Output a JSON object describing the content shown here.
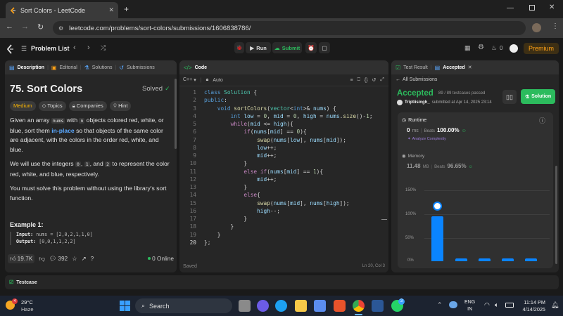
{
  "browser": {
    "tab_title": "Sort Colors - LeetCode",
    "url": "leetcode.com/problems/sort-colors/submissions/1606838786/"
  },
  "topbar": {
    "problem_list": "Problem List",
    "run": "Run",
    "submit": "Submit",
    "streak": "0",
    "premium": "Premium"
  },
  "description_panel": {
    "tabs": [
      "Description",
      "Editorial",
      "Solutions",
      "Submissions"
    ],
    "title": "75. Sort Colors",
    "status": "Solved",
    "tags": [
      "Medium",
      "Topics",
      "Companies",
      "Hint"
    ],
    "para1_a": "Given an array ",
    "para1_code": "nums",
    "para1_b": " with ",
    "para1_n": "n",
    "para1_c": " objects colored red, white, or blue, sort them ",
    "para1_link": "in-place",
    "para1_d": " so that objects of the same color are adjacent, with the colors in the order red, white, and blue.",
    "para2_a": "We will use the integers ",
    "c0": "0",
    "s1": ", ",
    "c1": "1",
    "s2": ", and ",
    "c2": "2",
    "para2_b": " to represent the color red, white, and blue, respectively.",
    "para3": "You must solve this problem without using the library's sort function.",
    "example_title": "Example 1:",
    "input_label": "Input:",
    "input_value": "nums = [2,0,2,1,1,0]",
    "output_label": "Output:",
    "output_value": "[0,0,1,1,2,2]",
    "likes": "19.7K",
    "comments": "392",
    "online": "0 Online"
  },
  "code_panel": {
    "title": "Code",
    "language": "C++",
    "auto": "Auto",
    "saved": "Saved",
    "cursor": "Ln 20, Col 3",
    "lines": [
      [
        [
          "kw2",
          "class "
        ],
        [
          "ty",
          "Solution"
        ],
        [
          "pl",
          " {"
        ]
      ],
      [
        [
          "kw2",
          "public"
        ],
        [
          "pl",
          ":"
        ]
      ],
      [
        [
          "pl",
          "    "
        ],
        [
          "kw2",
          "void "
        ],
        [
          "fn",
          "sortColors"
        ],
        [
          "pl",
          "("
        ],
        [
          "ty",
          "vector"
        ],
        [
          "pl",
          "<"
        ],
        [
          "kw2",
          "int"
        ],
        [
          "pl",
          ">& "
        ],
        [
          "id",
          "nums"
        ],
        [
          "pl",
          ") {"
        ]
      ],
      [
        [
          "pl",
          "        "
        ],
        [
          "kw2",
          "int "
        ],
        [
          "id",
          "low"
        ],
        [
          "pl",
          " = "
        ],
        [
          "num",
          "0"
        ],
        [
          "pl",
          ", "
        ],
        [
          "id",
          "mid"
        ],
        [
          "pl",
          " = "
        ],
        [
          "num",
          "0"
        ],
        [
          "pl",
          ", "
        ],
        [
          "id",
          "high"
        ],
        [
          "pl",
          " = "
        ],
        [
          "id",
          "nums"
        ],
        [
          "pl",
          "."
        ],
        [
          "fn",
          "size"
        ],
        [
          "pl",
          "()-"
        ],
        [
          "num",
          "1"
        ],
        [
          "pl",
          ";"
        ]
      ],
      [
        [
          "pl",
          "        "
        ],
        [
          "kw",
          "while"
        ],
        [
          "pl",
          "("
        ],
        [
          "id",
          "mid"
        ],
        [
          "pl",
          " <= "
        ],
        [
          "id",
          "high"
        ],
        [
          "pl",
          "){"
        ]
      ],
      [
        [
          "pl",
          "            "
        ],
        [
          "kw",
          "if"
        ],
        [
          "pl",
          "("
        ],
        [
          "id",
          "nums"
        ],
        [
          "pl",
          "["
        ],
        [
          "id",
          "mid"
        ],
        [
          "pl",
          "] == "
        ],
        [
          "num",
          "0"
        ],
        [
          "pl",
          "){"
        ]
      ],
      [
        [
          "pl",
          "                "
        ],
        [
          "fn",
          "swap"
        ],
        [
          "pl",
          "("
        ],
        [
          "id",
          "nums"
        ],
        [
          "pl",
          "["
        ],
        [
          "id",
          "low"
        ],
        [
          "pl",
          "], "
        ],
        [
          "id",
          "nums"
        ],
        [
          "pl",
          "["
        ],
        [
          "id",
          "mid"
        ],
        [
          "pl",
          "]);"
        ]
      ],
      [
        [
          "pl",
          "                "
        ],
        [
          "id",
          "low"
        ],
        [
          "pl",
          "++;"
        ]
      ],
      [
        [
          "pl",
          "                "
        ],
        [
          "id",
          "mid"
        ],
        [
          "pl",
          "++;"
        ]
      ],
      [
        [
          "pl",
          "            }"
        ]
      ],
      [
        [
          "pl",
          "            "
        ],
        [
          "kw",
          "else if"
        ],
        [
          "pl",
          "("
        ],
        [
          "id",
          "nums"
        ],
        [
          "pl",
          "["
        ],
        [
          "id",
          "mid"
        ],
        [
          "pl",
          "] == "
        ],
        [
          "num",
          "1"
        ],
        [
          "pl",
          "){"
        ]
      ],
      [
        [
          "pl",
          "                "
        ],
        [
          "id",
          "mid"
        ],
        [
          "pl",
          "++;"
        ]
      ],
      [
        [
          "pl",
          "            }"
        ]
      ],
      [
        [
          "pl",
          "            "
        ],
        [
          "kw",
          "else"
        ],
        [
          "pl",
          "{"
        ]
      ],
      [
        [
          "pl",
          "                "
        ],
        [
          "fn",
          "swap"
        ],
        [
          "pl",
          "("
        ],
        [
          "id",
          "nums"
        ],
        [
          "pl",
          "["
        ],
        [
          "id",
          "mid"
        ],
        [
          "pl",
          "], "
        ],
        [
          "id",
          "nums"
        ],
        [
          "pl",
          "["
        ],
        [
          "id",
          "high"
        ],
        [
          "pl",
          "]);"
        ]
      ],
      [
        [
          "pl",
          "                "
        ],
        [
          "id",
          "high"
        ],
        [
          "pl",
          "--;"
        ]
      ],
      [
        [
          "pl",
          "            }"
        ]
      ],
      [
        [
          "pl",
          "        }"
        ]
      ],
      [
        [
          "pl",
          "    }"
        ]
      ],
      [
        [
          "pl",
          "};"
        ]
      ]
    ]
  },
  "result_panel": {
    "tabs": [
      "Test Result",
      "Accepted"
    ],
    "back": "All Submissions",
    "status": "Accepted",
    "passed": "89 / 89 testcases passed",
    "user": "Triptiisingh_",
    "submitted": "submitted at Apr 14, 2025 23:14",
    "solution_btn": "Solution",
    "runtime_label": "Runtime",
    "runtime_value": "0",
    "runtime_unit": "ms",
    "beats_label": "Beats",
    "runtime_beats": "100.00%",
    "analyze": "Analyze Complexity",
    "memory_label": "Memory",
    "memory_value": "11.48",
    "memory_unit": "MB",
    "memory_beats": "96.65%",
    "axis": [
      "150%",
      "100%",
      "50%",
      "0%"
    ],
    "bar_fraction": 0.95
  },
  "testcase_bar": {
    "label": "Testcase"
  },
  "taskbar": {
    "temp": "29°C",
    "weather": "Haze",
    "search": "Search",
    "lang1": "ENG",
    "lang2": "IN",
    "time": "11:14 PM",
    "date": "4/14/2025",
    "weather_badge": "4",
    "whatsapp_badge": "3"
  },
  "colors": {
    "accent_green": "#2cbb5d",
    "premium": "#ffa116",
    "medium": "#ffb800",
    "link_blue": "#5aa8ff",
    "bar_blue": "#0a84ff"
  }
}
